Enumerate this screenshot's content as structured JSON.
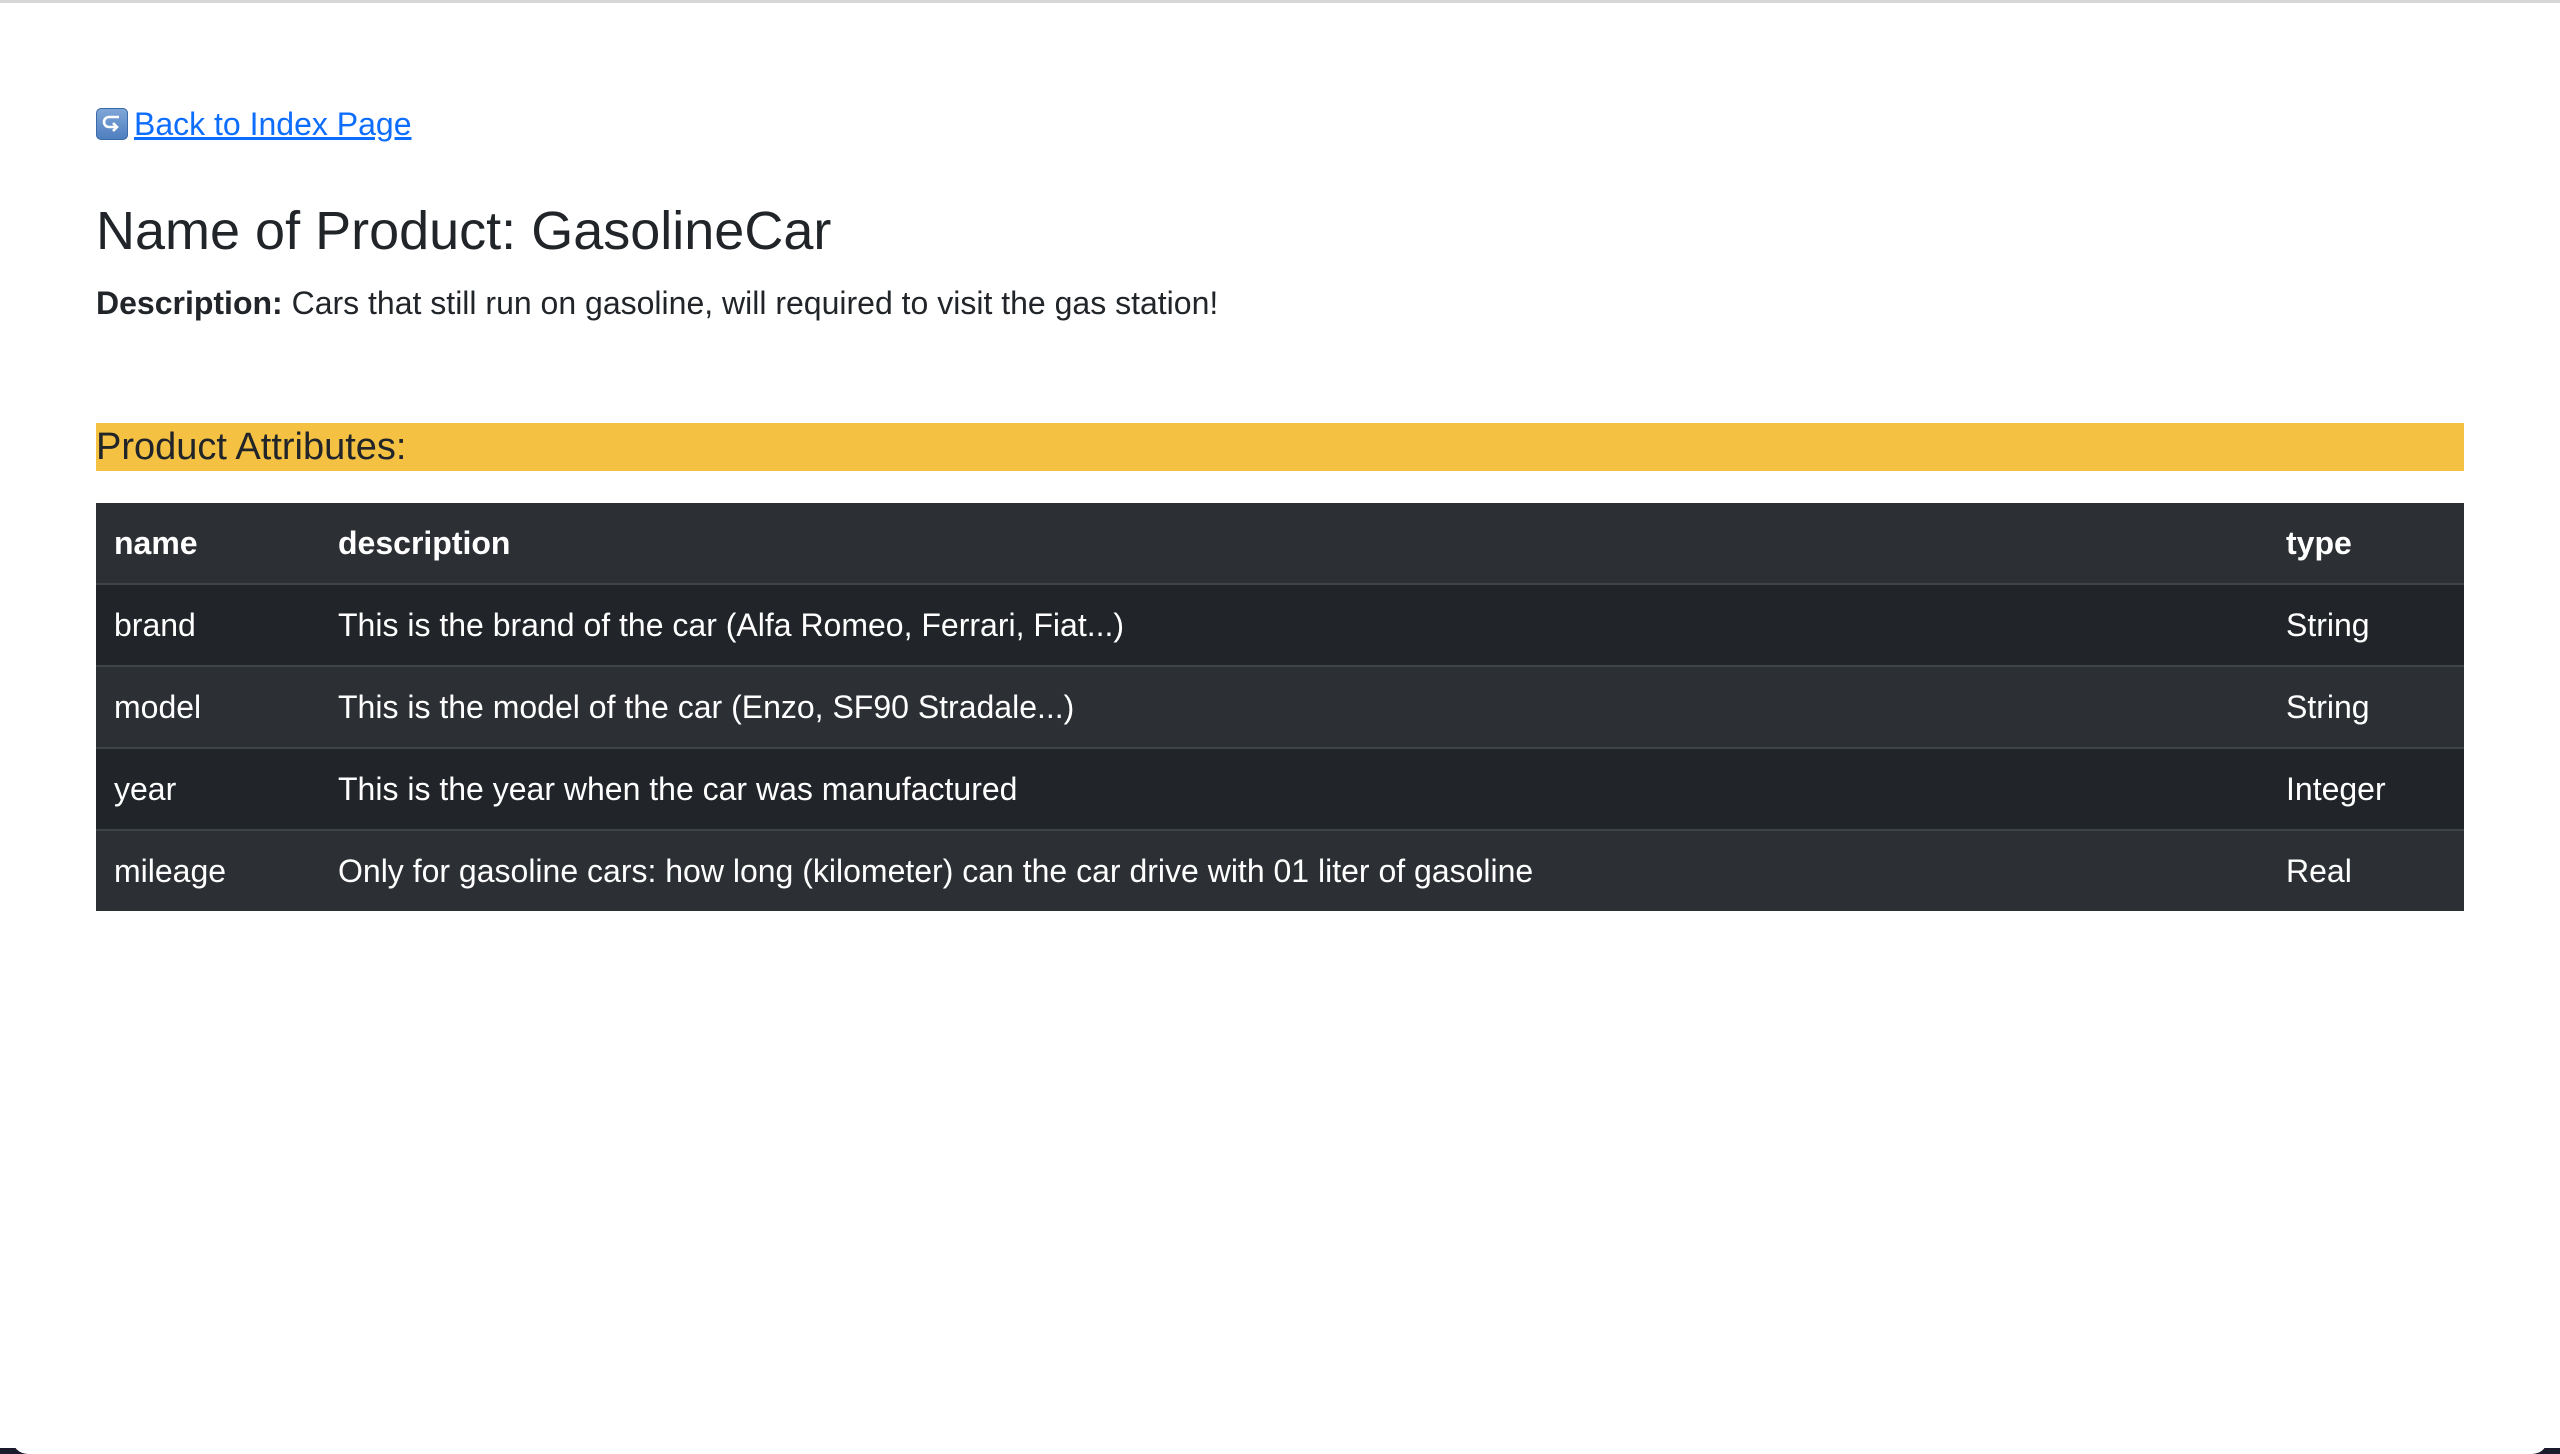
{
  "nav": {
    "back_label": "Back to Index Page"
  },
  "product": {
    "title": "Name of Product: GasolineCar",
    "description_label": "Description:",
    "description_text": "Cars that still run on gasoline, will required to visit the gas station!"
  },
  "attributes": {
    "heading": "Product Attributes:",
    "columns": [
      "name",
      "description",
      "type"
    ],
    "rows": [
      {
        "name": "brand",
        "description": "This is the brand of the car (Alfa Romeo, Ferrari, Fiat...)",
        "type": "String"
      },
      {
        "name": "model",
        "description": "This is the model of the car (Enzo, SF90 Stradale...)",
        "type": "String"
      },
      {
        "name": "year",
        "description": "This is the year when the car was manufactured",
        "type": "Integer"
      },
      {
        "name": "mileage",
        "description": "Only for gasoline cars: how long (kilometer) can the car drive with 01 liter of gasoline",
        "type": "Real"
      }
    ]
  },
  "colors": {
    "link": "#0d6efd",
    "heading_highlight": "#f4c143",
    "table_dark": "#212529",
    "table_stripe": "#2c3034"
  },
  "icons": {
    "back": "return-arrow-icon"
  }
}
